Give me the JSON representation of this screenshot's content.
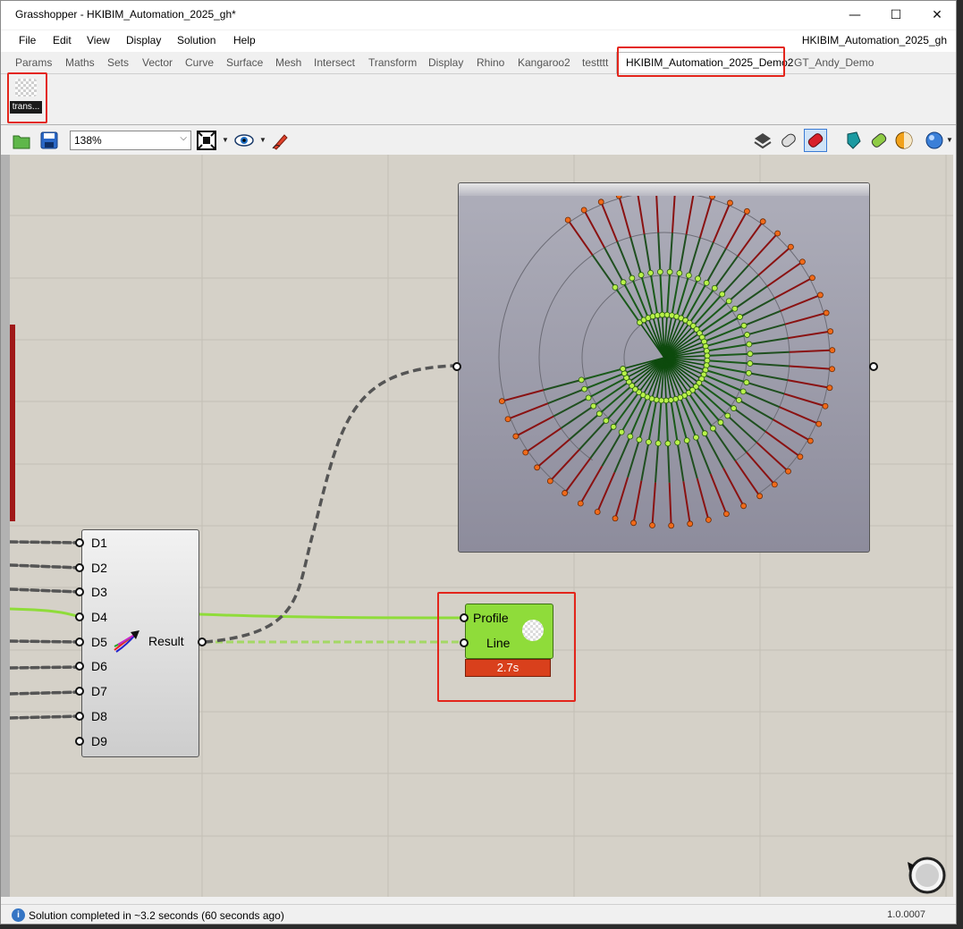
{
  "window": {
    "title": "Grasshopper - HKIBIM_Automation_2025_gh*",
    "minimize_glyph": "—",
    "maximize_glyph": "☐",
    "close_glyph": "✕"
  },
  "menu": {
    "items": [
      "File",
      "Edit",
      "View",
      "Display",
      "Solution",
      "Help"
    ],
    "document_name": "HKIBIM_Automation_2025_gh"
  },
  "tabs": {
    "items": [
      "Params",
      "Maths",
      "Sets",
      "Vector",
      "Curve",
      "Surface",
      "Mesh",
      "Intersect",
      "Transform",
      "Display",
      "Rhino",
      "Kangaroo2",
      "testttt"
    ],
    "active": "HKIBIM_Automation_2025_Demo2",
    "after": "GT_Andy_Demo"
  },
  "ribbon": {
    "component_label": "trans..."
  },
  "toolbar": {
    "zoom": "138%",
    "icons": [
      "open-file-icon",
      "save-file-icon",
      "zoom-extents-icon",
      "preview-eye-icon",
      "sketch-pen-icon",
      "wireframe-preview-icon",
      "shaded-mesh-icon",
      "selected-only-preview-icon",
      "document-preview-icon",
      "material-preview-icon",
      "colour-swatch-icon",
      "display-sphere-icon"
    ]
  },
  "merge_component": {
    "inputs": [
      "D1",
      "D2",
      "D3",
      "D4",
      "D5",
      "D6",
      "D7",
      "D8",
      "D9"
    ],
    "output": "Result"
  },
  "sweep_component": {
    "inputs": [
      "Profile",
      "Line"
    ],
    "runtime": "2.7s"
  },
  "status": {
    "message": "Solution completed in ~3.2 seconds (60 seconds ago)",
    "version": "1.0.0007"
  },
  "colors": {
    "accent_red_outline": "#e3251b",
    "canvas": "#d5d1c8",
    "wire_green": "#8fdc3a",
    "runtime_warning": "#d9401c"
  }
}
